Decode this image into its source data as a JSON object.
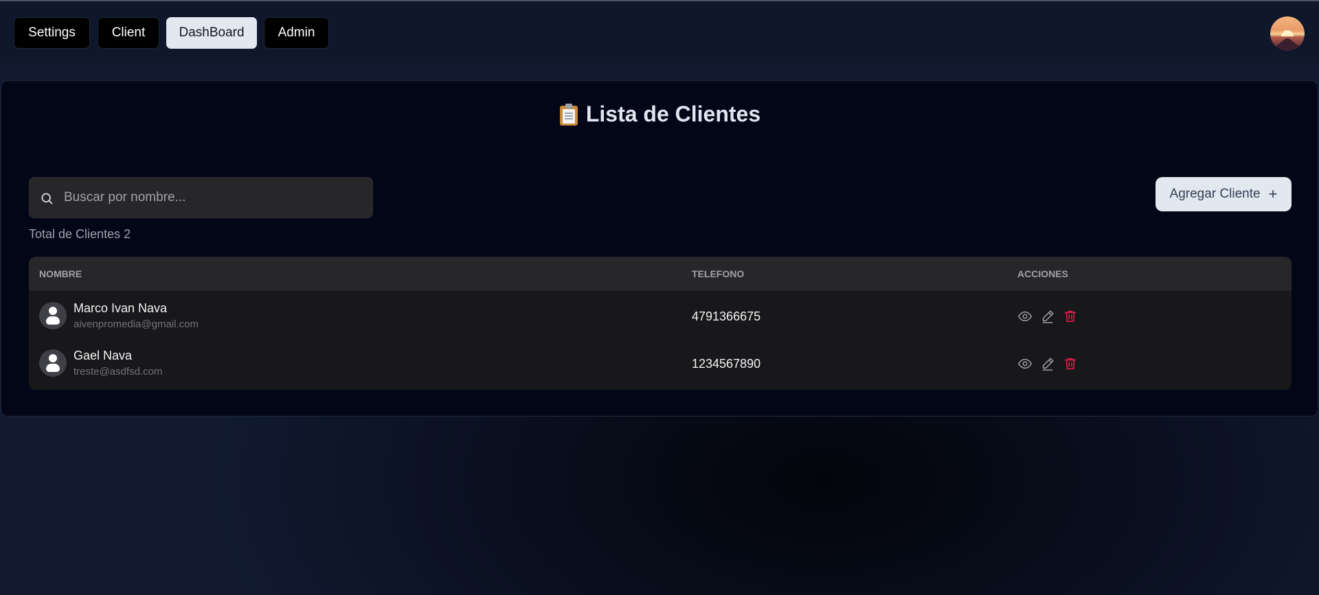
{
  "nav": {
    "items": [
      {
        "label": "Settings",
        "active": false
      },
      {
        "label": "Client",
        "active": false
      },
      {
        "label": "DashBoard",
        "active": true
      },
      {
        "label": "Admin",
        "active": false
      }
    ],
    "avatar_icon": "profile-avatar"
  },
  "page": {
    "title_icon": "clipboard-icon",
    "title": "Lista de Clientes",
    "search": {
      "placeholder": "Buscar por nombre...",
      "value": ""
    },
    "add_button": {
      "label": "Agregar Cliente",
      "icon": "plus-icon"
    },
    "total_text": "Total de Clientes 2"
  },
  "table": {
    "columns": [
      "NOMBRE",
      "TELEFONO",
      "ACCIONES"
    ],
    "rows": [
      {
        "name": "Marco Ivan Nava",
        "email": "aivenpromedia@gmail.com",
        "phone": "4791366675"
      },
      {
        "name": "Gael Nava",
        "email": "treste@asdfsd.com",
        "phone": "1234567890"
      }
    ],
    "action_icons": [
      "eye-icon",
      "pencil-icon",
      "trash-icon"
    ]
  },
  "colors": {
    "background": "#0d1426",
    "panel": "#020617",
    "active_tab": "#e2e8f0",
    "delete": "#e11d48",
    "table_header": "#27272a",
    "table_body": "#18181b"
  }
}
